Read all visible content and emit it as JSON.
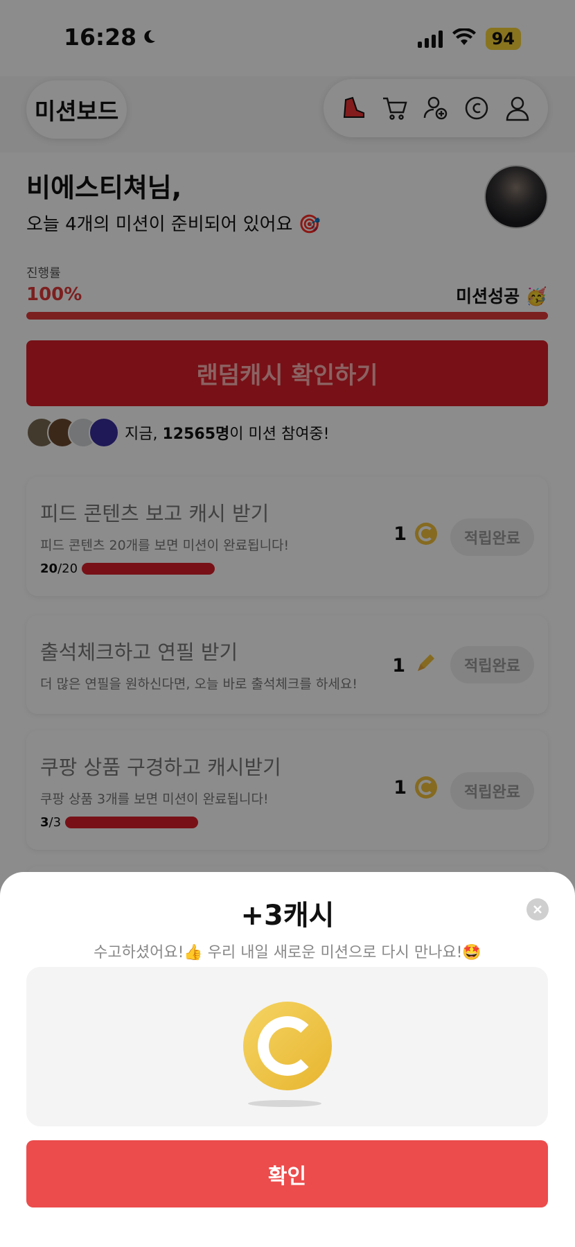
{
  "status_bar": {
    "time": "16:28",
    "battery": "94"
  },
  "header": {
    "title": "미션보드"
  },
  "greeting": {
    "name": "비에스티쳐님,",
    "subtitle": "오늘 4개의 미션이 준비되어 있어요 🎯"
  },
  "progress": {
    "label": "진행률",
    "percent_text": "100%",
    "percent": 100,
    "status": "미션성공 🥳"
  },
  "random_cash_button": "랜덤캐시 확인하기",
  "participants": {
    "prefix": "지금, ",
    "count": "12565명",
    "suffix": "이 미션 참여중!"
  },
  "missions": [
    {
      "title": "피드 콘텐츠 보고 캐시 받기",
      "description": "피드 콘텐츠 20개를 보면 미션이 완료됩니다!",
      "count_done": "20",
      "count_total": "/20",
      "reward": "1",
      "reward_icon": "coin-icon",
      "button": "적립완료"
    },
    {
      "title": "출석체크하고 연필 받기",
      "description": "더 많은 연필을 원하신다면, 오늘 바로 출석체크를 하세요!",
      "reward": "1",
      "reward_icon": "pencil-icon",
      "button": "적립완료"
    },
    {
      "title": "쿠팡 상품 구경하고 캐시받기",
      "description": "쿠팡 상품 3개를 보면 미션이 완료됩니다!",
      "count_done": "3",
      "count_total": "/3",
      "reward": "1",
      "reward_icon": "coin-icon",
      "button": "적립완료"
    }
  ],
  "sheet": {
    "title": "+3캐시",
    "message": "수고하셨어요!👍 우리 내일 새로운 미션으로 다시 만나요!🤩",
    "confirm": "확인"
  },
  "colors": {
    "accent": "#e23a3a",
    "button_red": "#ec4c4c",
    "coin": "#f3c13b"
  }
}
